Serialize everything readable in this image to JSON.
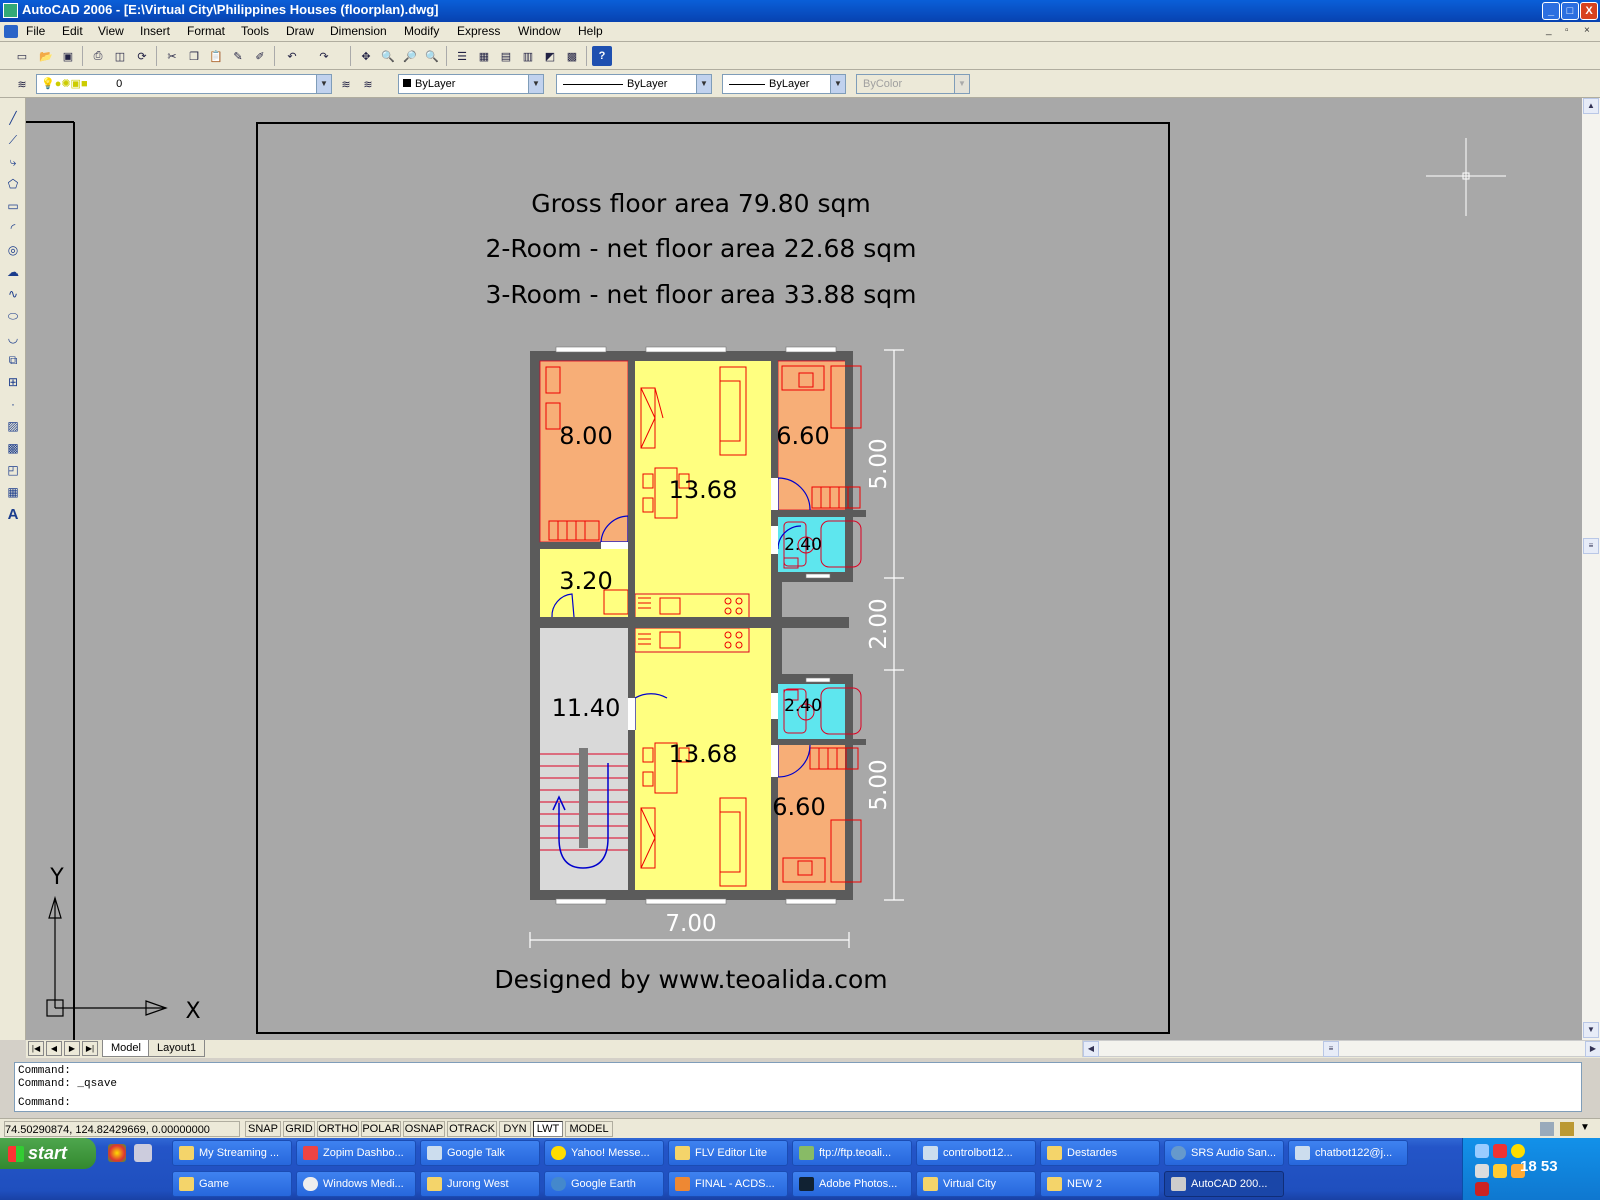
{
  "window": {
    "title": "AutoCAD 2006 - [E:\\Virtual City\\Philippines Houses (floorplan).dwg]",
    "controls": [
      "_",
      "□",
      "X"
    ]
  },
  "menu": [
    "File",
    "Edit",
    "View",
    "Insert",
    "Format",
    "Tools",
    "Draw",
    "Dimension",
    "Modify",
    "Express",
    "Window",
    "Help"
  ],
  "properties_toolbar": {
    "layer": "0",
    "color": "ByLayer",
    "linetype": "ByLayer",
    "lineweight": "ByLayer",
    "plotstyle": "ByColor"
  },
  "drawing": {
    "lines": [
      "Gross floor area 79.80 sqm",
      "2-Room - net floor area 22.68 sqm",
      "3-Room - net floor area 33.88 sqm"
    ],
    "credit": "Designed by www.teoalida.com",
    "rooms": {
      "bedroom_a": "8.00",
      "living_a": "13.68",
      "bedroom_b": "6.60",
      "bath_a": "2.40",
      "storage": "3.20",
      "stair": "11.40",
      "living_b": "13.68",
      "bath_b": "2.40",
      "bedroom_c": "6.60"
    },
    "dims": {
      "d1": "5.00",
      "d2": "2.00",
      "d3": "5.00",
      "width": "7.00"
    },
    "ucs": {
      "y": "Y",
      "x": "X"
    }
  },
  "tabs": [
    "Model",
    "Layout1"
  ],
  "command": [
    "Command:",
    "Command: _qsave",
    "Command:"
  ],
  "status": {
    "coords": "74.50290874, 124.82429669, 0.00000000",
    "toggles": [
      "SNAP",
      "GRID",
      "ORTHO",
      "POLAR",
      "OSNAP",
      "OTRACK",
      "DYN",
      "LWT",
      "MODEL"
    ]
  },
  "taskbar": {
    "start": "start",
    "row1": [
      "My Streaming ...",
      "Zopim Dashbo...",
      "Google Talk",
      "Yahoo! Messe...",
      "FLV Editor Lite",
      "ftp://ftp.teoali...",
      "controlbot12...",
      "Destardes",
      "SRS Audio San...",
      "chatbot122@j..."
    ],
    "row2": [
      "Game",
      "Windows Medi...",
      "Jurong West",
      "Google Earth",
      "FINAL - ACDS...",
      "Adobe Photos...",
      "Virtual City",
      "NEW 2",
      "AutoCAD 200..."
    ],
    "clock": "18 53"
  }
}
